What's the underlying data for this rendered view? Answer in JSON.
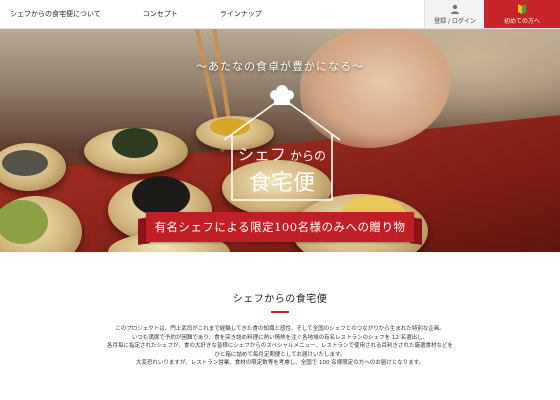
{
  "header": {
    "nav": [
      {
        "label": "シェフからの食宅便について"
      },
      {
        "label": "コンセプト"
      },
      {
        "label": "ラインナップ"
      }
    ],
    "login_label": "登録 / ログイン",
    "first_label": "初めての方へ",
    "accent_color": "#c6262a"
  },
  "hero": {
    "tagline": "〜あたなの食卓が豊かになる〜",
    "logo": {
      "line1_a": "シェフ",
      "line1_b": "からの",
      "line2": "食宅便"
    },
    "banner": "有名シェフによる限定100名様のみへの贈り物"
  },
  "about": {
    "title": "シェフからの食宅便",
    "paragraphs": [
      "このプロジェクトは、門上武司がこれまで経験してきた食の知識と感性、そして全国のシェフとのつながりから生まれた特別な企画。",
      "いつも満席で予約が困難であり、食を突き詰め料理に熱い情熱を注ぐ各地域の有名レストランのシェフを 12 名選出し、",
      "各月毎に指定されたシェフが、食の大好きな皆様にシェフからのスペシャルメニュー、レストランで使用される目利きされた厳選食材などを",
      "ひと箱に詰めて毎月定期便としてお届けいたします。",
      "大変恐れいりますが、レストラン営業、食材の限定数等を考慮し、全国で 100 名様限定の方へのお届けとなります。"
    ]
  }
}
